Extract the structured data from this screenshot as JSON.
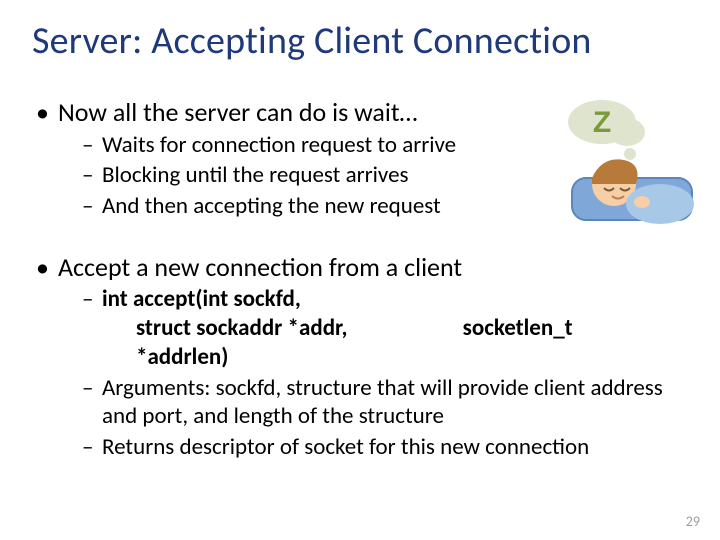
{
  "title": "Server: Accepting Client Connection",
  "b1": {
    "text": "Now all the server can do is wait…",
    "sub": [
      "Waits for connection request to arrive",
      "Blocking until the request arrives",
      "And then accepting the new request"
    ]
  },
  "b2": {
    "text": "Accept a new connection from a client",
    "sig": {
      "l1": "int accept(int sockfd,",
      "l2a": "struct sockaddr *addr,",
      "l2b": "socketlen_t",
      "l3": "*addrlen)"
    },
    "sub2": "Arguments: sockfd, structure that will provide client address and port, and length of the structure",
    "sub3": "Returns descriptor of socket for this new connection"
  },
  "sleep_letter": "Z",
  "page": "29"
}
